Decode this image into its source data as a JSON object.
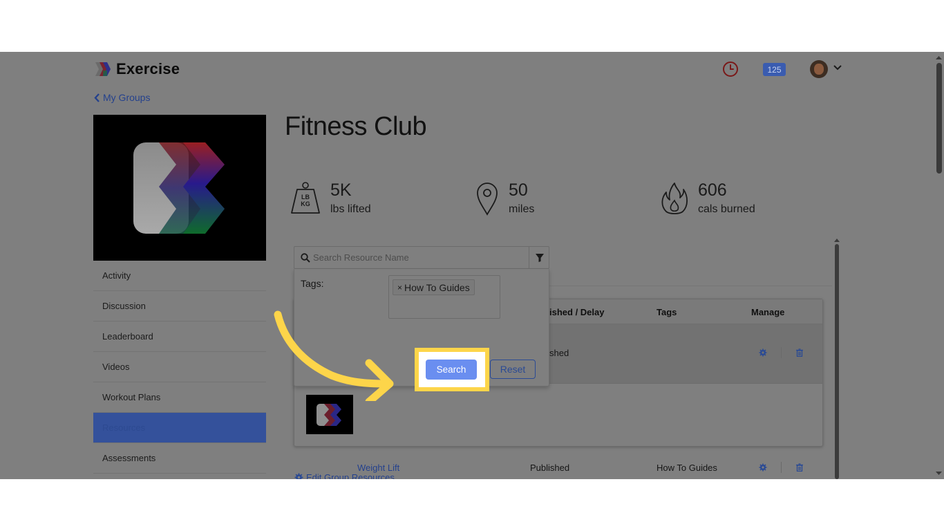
{
  "app": {
    "name": "Exercise",
    "notifications_count": "125"
  },
  "nav": {
    "back_label": "My Groups"
  },
  "group": {
    "title": "Fitness Club"
  },
  "stats": [
    {
      "value": "5K",
      "label": "lbs lifted",
      "icon": "weight-icon",
      "icon_text": "LB KG"
    },
    {
      "value": "50",
      "label": "miles",
      "icon": "location-pin-icon"
    },
    {
      "value": "606",
      "label": "cals burned",
      "icon": "flame-icon"
    }
  ],
  "sidebar": {
    "items": [
      {
        "label": "Activity"
      },
      {
        "label": "Discussion"
      },
      {
        "label": "Leaderboard"
      },
      {
        "label": "Videos"
      },
      {
        "label": "Workout Plans"
      },
      {
        "label": "Resources",
        "active": true
      },
      {
        "label": "Assessments"
      }
    ]
  },
  "search": {
    "placeholder": "Search Resource Name",
    "value": ""
  },
  "filter": {
    "tags_label": "Tags:",
    "selected_tags": [
      "How To Guides"
    ],
    "remove_symbol": "×",
    "search_button": "Search",
    "reset_button": "Reset"
  },
  "table": {
    "columns": {
      "published": "Published / Delay",
      "published_visible": "ished / Delay",
      "tags": "Tags",
      "manage": "Manage"
    },
    "rows": [
      {
        "name": "",
        "status": "Published",
        "status_visible": "shed",
        "tags": ""
      },
      {
        "name": "Weight Lift",
        "status": "Published",
        "tags": "How To Guides"
      }
    ]
  },
  "footer_link": {
    "label": "Edit Group Resources"
  },
  "colors": {
    "overlay": "#7f7f7f",
    "highlight": "#fdd54a",
    "accent": "#6a8ef0",
    "link": "#24418d"
  }
}
